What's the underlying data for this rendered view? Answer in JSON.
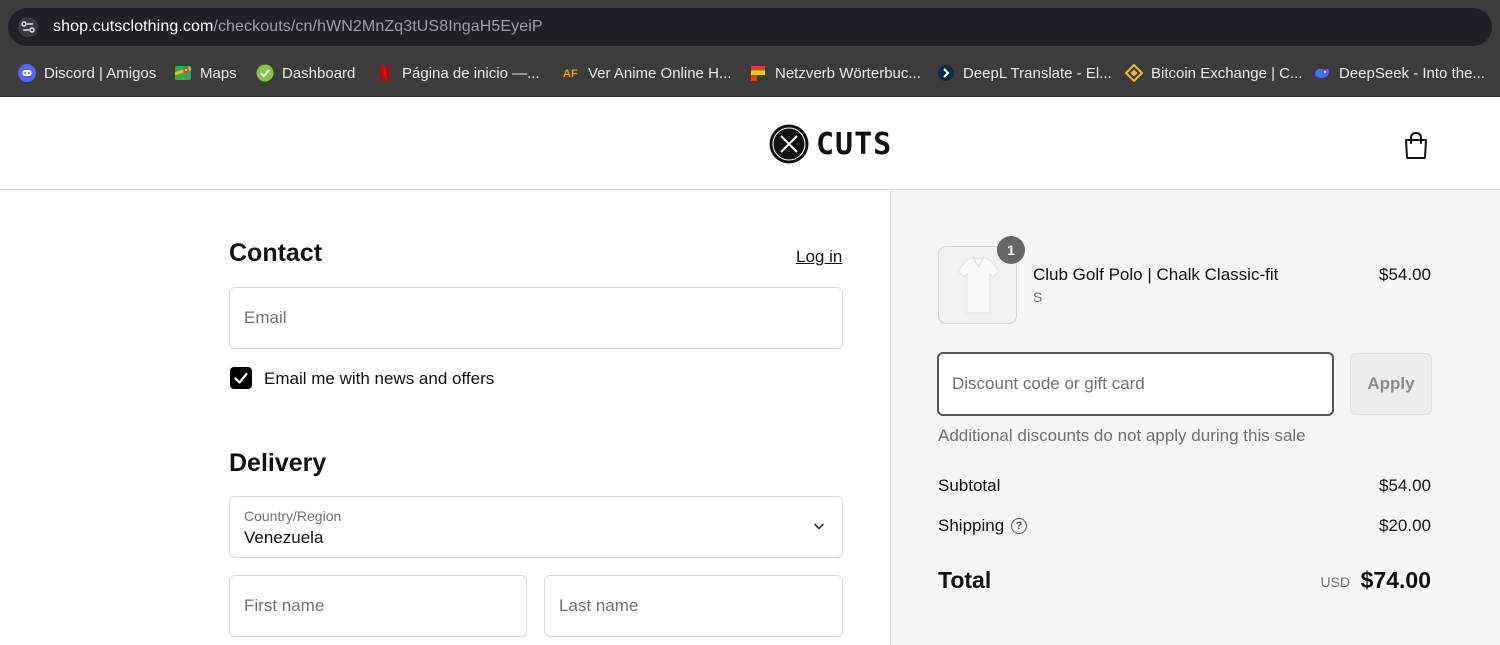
{
  "browser": {
    "url_host": "shop.cutsclothing.com",
    "url_path": "/checkouts/cn/hWN2MnZq3tUS8IngaH5EyeiP",
    "bookmarks": [
      {
        "label": "Discord | Amigos",
        "icon": "discord-icon",
        "color": "#5865f2"
      },
      {
        "label": "Maps",
        "icon": "maps-icon",
        "color": "#34a853"
      },
      {
        "label": "Dashboard",
        "icon": "dashboard-icon",
        "color": "#8bc34a"
      },
      {
        "label": "Página de inicio —...",
        "icon": "netflix-icon",
        "color": "#e50914"
      },
      {
        "label": "Ver Anime Online H...",
        "icon": "animeflv-icon",
        "color": "#f2a100"
      },
      {
        "label": "Netzverb Wörterbuc...",
        "icon": "netzverb-flag-icon",
        "color": "#ffcc00"
      },
      {
        "label": "DeepL Translate - El...",
        "icon": "deepl-icon",
        "color": "#0f2b46"
      },
      {
        "label": "Bitcoin Exchange | C...",
        "icon": "binance-icon",
        "color": "#f3ba2f"
      },
      {
        "label": "DeepSeek - Into the...",
        "icon": "deepseek-icon",
        "color": "#4d6bfe"
      }
    ]
  },
  "header": {
    "brand": "CUTS",
    "cart_icon": "shopping-bag-icon"
  },
  "contact": {
    "title": "Contact",
    "login_link": "Log in",
    "email_placeholder": "Email",
    "email_value": "",
    "news_checkbox_label": "Email me with news and offers",
    "news_checked": true
  },
  "delivery": {
    "title": "Delivery",
    "country_label": "Country/Region",
    "country_value": "Venezuela",
    "first_name_placeholder": "First name",
    "last_name_placeholder": "Last name"
  },
  "summary": {
    "item": {
      "quantity": "1",
      "name": "Club Golf Polo | Chalk Classic-fit",
      "variant": "S",
      "price": "$54.00"
    },
    "discount_placeholder": "Discount code or gift card",
    "apply_label": "Apply",
    "discount_note": "Additional discounts do not apply during this sale",
    "subtotal_label": "Subtotal",
    "subtotal_value": "$54.00",
    "shipping_label": "Shipping",
    "shipping_value": "$20.00",
    "total_label": "Total",
    "total_currency": "USD",
    "total_value": "$74.00"
  },
  "colors": {
    "chrome_bg": "#3c3c3c",
    "summary_bg": "#f5f5f5",
    "checkbox": "#000000"
  }
}
